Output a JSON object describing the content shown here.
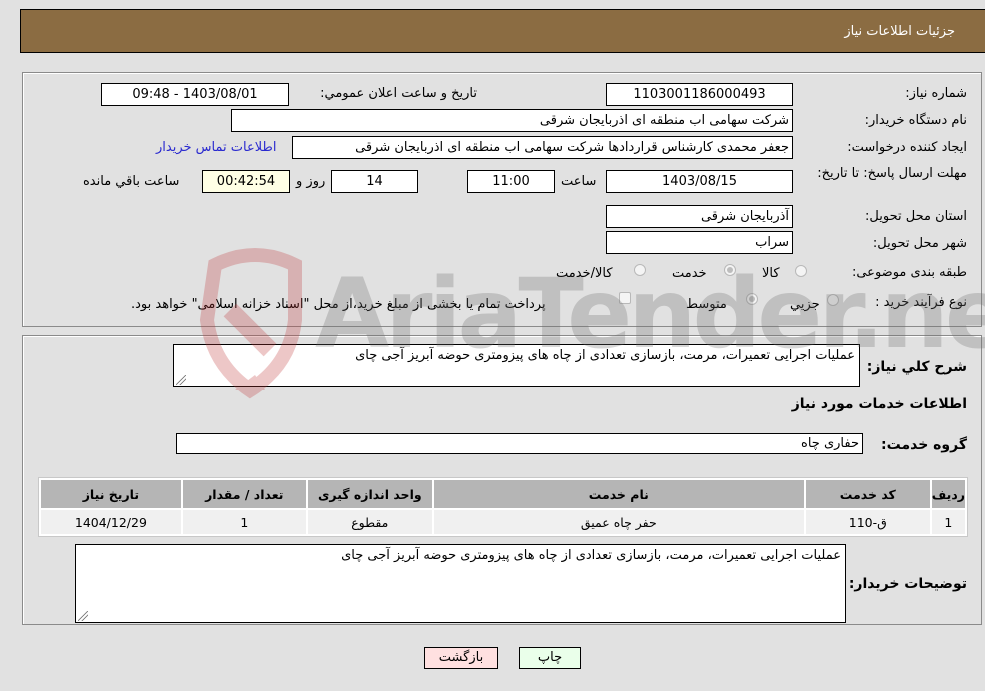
{
  "header": {
    "title": "جزئیات اطلاعات نیاز"
  },
  "details": {
    "need_number_label": "شماره نیاز:",
    "need_number": "1103001186000493",
    "announce_label": "تاریخ و ساعت اعلان عمومي:",
    "announce_value": "1403/08/01 - 09:48",
    "buyer_org_label": "نام دستگاه خريدار:",
    "buyer_org": "شرکت سهامی اب منطقه ای اذربایجان شرقی",
    "requester_label": "ایجاد کننده درخواست:",
    "requester": "جعفر محمدی کارشناس قراردادها شرکت سهامی اب منطقه ای اذربایجان شرقی",
    "contact_link": "اطلاعات تماس خریدار",
    "deadline_label": "مهلت ارسال پاسخ: تا تاریخ:",
    "deadline_date": "1403/08/15",
    "time_label": "ساعت",
    "deadline_time": "11:00",
    "days_value": "14",
    "days_label": "روز و",
    "remaining_time": "00:42:54",
    "remaining_label": "ساعت باقي مانده",
    "province_label": "استان محل تحویل:",
    "province": "آذربایجان شرقی",
    "city_label": "شهر محل تحویل:",
    "city": "سراب",
    "category_label": "طبقه بندی موضوعی:",
    "category_options": [
      {
        "label": "کالا",
        "checked": false
      },
      {
        "label": "خدمت",
        "checked": true
      },
      {
        "label": "کالا/خدمت",
        "checked": false
      }
    ],
    "process_label": "نوع فرآیند خرید :",
    "process_options": [
      {
        "label": "جزیي",
        "checked": false
      },
      {
        "label": "متوسط",
        "checked": true
      }
    ],
    "treasury_note": "پرداخت تمام یا بخشی از مبلغ خرید،از محل \"اسناد خزانه اسلامی\" خواهد بود."
  },
  "description": {
    "label": "شرح كلي نياز:",
    "value": "عملیات اجرایی تعمیرات، مرمت، بازسازی تعدادی از چاه های پیزومتری حوضه آبریز آجی چای"
  },
  "services": {
    "section_title": "اطلاعات خدمات مورد نياز",
    "group_label": "گروه خدمت:",
    "group_value": "حفاری چاه",
    "table": {
      "headers": [
        "رديف",
        "کد خدمت",
        "نام خدمت",
        "واحد اندازه گیری",
        "تعداد / مقدار",
        "تاریخ نیاز"
      ],
      "rows": [
        [
          "1",
          "ق-110",
          "حفر چاه عمیق",
          "مقطوع",
          "1",
          "1404/12/29"
        ]
      ]
    },
    "buyer_notes_label": "توضیحات خریدار:",
    "buyer_notes": "عملیات اجرایی تعمیرات، مرمت، بازسازی تعدادی از چاه های پیزومتری حوضه آبریز آجی چای"
  },
  "buttons": {
    "print": "چاپ",
    "back": "بازگشت"
  },
  "watermark": {
    "text": "AriaTender.neT"
  }
}
